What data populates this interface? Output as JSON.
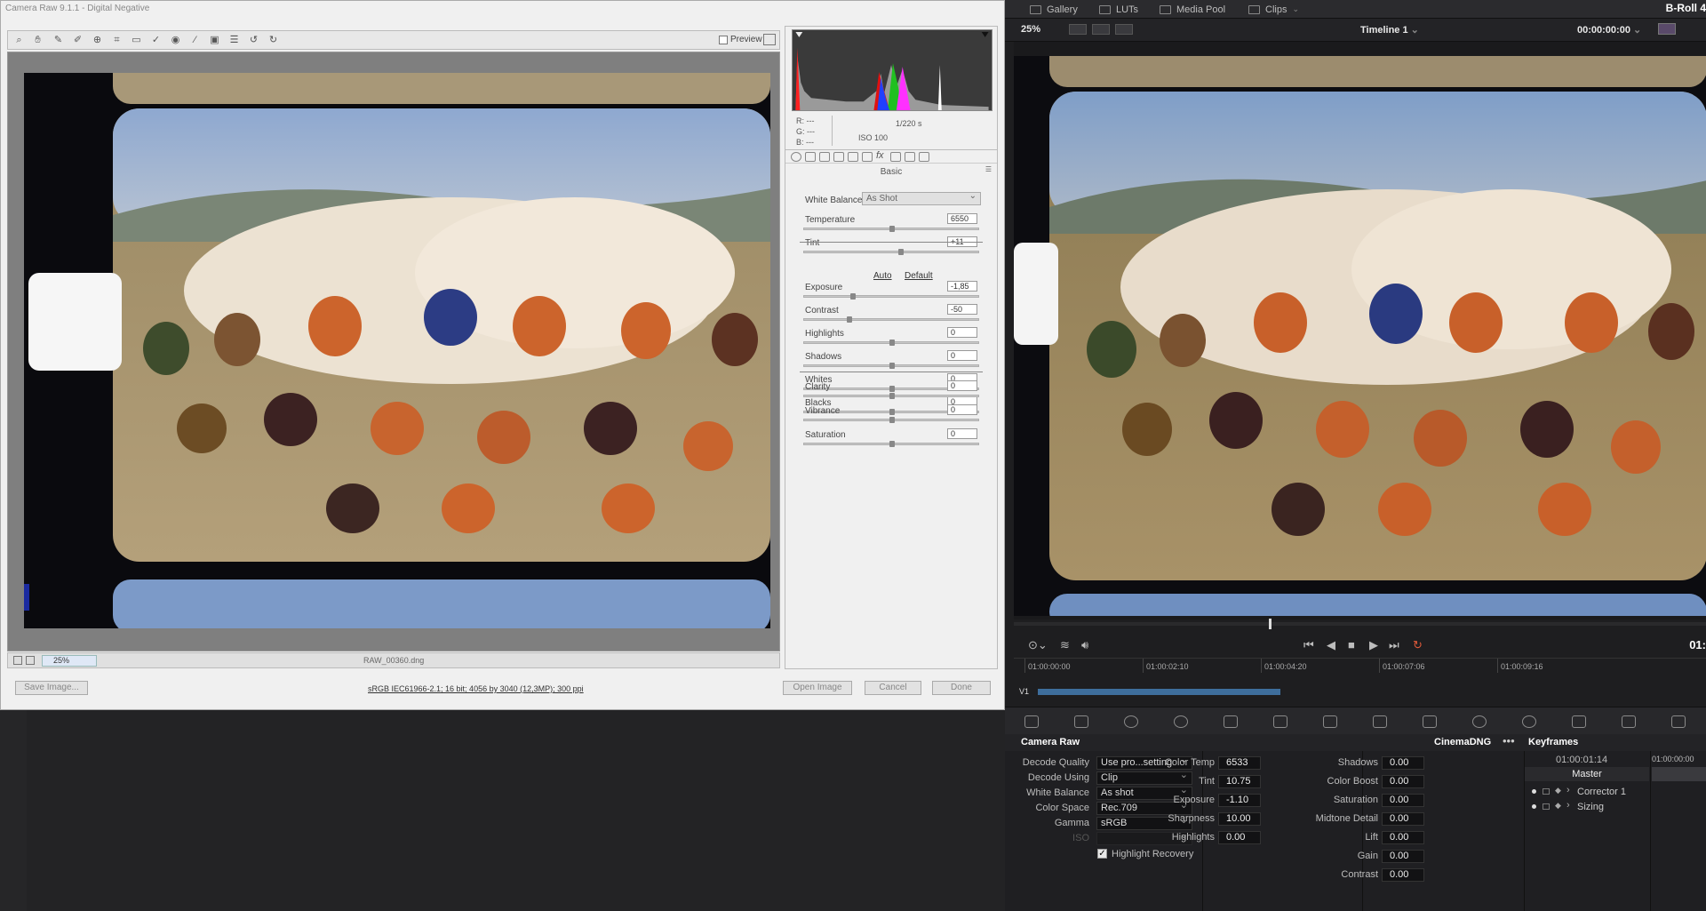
{
  "camera_raw": {
    "title": "Camera Raw 9.1.1  -  Digital Negative",
    "preview_label": "Preview",
    "rgb": {
      "r": "R:   ---",
      "g": "G:   ---",
      "b": "B:   ---"
    },
    "shutter": "1/220 s",
    "iso": "ISO 100",
    "panel_title": "Basic",
    "white_balance_label": "White Balance:",
    "white_balance_value": "As Shot",
    "sliders_wb": [
      {
        "label": "Temperature",
        "value": "6550",
        "pos": 0.5
      },
      {
        "label": "Tint",
        "value": "+11",
        "pos": 0.55
      }
    ],
    "auto_label": "Auto",
    "default_label": "Default",
    "sliders_tone": [
      {
        "label": "Exposure",
        "value": "-1,85",
        "pos": 0.27
      },
      {
        "label": "Contrast",
        "value": "-50",
        "pos": 0.25
      },
      {
        "label": "Highlights",
        "value": "0",
        "pos": 0.5
      },
      {
        "label": "Shadows",
        "value": "0",
        "pos": 0.5
      },
      {
        "label": "Whites",
        "value": "0",
        "pos": 0.5
      },
      {
        "label": "Blacks",
        "value": "0",
        "pos": 0.5
      }
    ],
    "sliders_presence": [
      {
        "label": "Clarity",
        "value": "0",
        "pos": 0.5
      },
      {
        "label": "Vibrance",
        "value": "0",
        "pos": 0.5
      },
      {
        "label": "Saturation",
        "value": "0",
        "pos": 0.5
      }
    ],
    "zoom": "25%",
    "filename": "RAW_00360.dng",
    "save_image": "Save Image...",
    "workflow_info": "sRGB IEC61966-2.1; 16 bit; 4056 by 3040 (12,3MP); 300 ppi",
    "open_image": "Open Image",
    "cancel": "Cancel",
    "done": "Done"
  },
  "resolve": {
    "tabs": [
      "Gallery",
      "LUTs",
      "Media Pool",
      "Clips"
    ],
    "project": "B-Roll 4",
    "viewer_zoom": "25%",
    "timeline_name": "Timeline 1",
    "timecode": "00:00:00:00",
    "timecode_right": "01:",
    "ruler": [
      "01:00:00:00",
      "01:00:02:10",
      "01:00:04:20",
      "01:00:07:06",
      "01:00:09:16"
    ],
    "track": "V1",
    "panel_title": "Camera Raw",
    "format": "CinemaDNG",
    "keyframes_title": "Keyframes",
    "decode": [
      {
        "label": "Decode Quality",
        "value": "Use pro...setting"
      },
      {
        "label": "Decode Using",
        "value": "Clip"
      },
      {
        "label": "White Balance",
        "value": "As shot"
      },
      {
        "label": "Color Space",
        "value": "Rec.709"
      },
      {
        "label": "Gamma",
        "value": "sRGB"
      },
      {
        "label": "ISO",
        "value": ""
      }
    ],
    "highlight_recovery": "Highlight Recovery",
    "params_mid": [
      {
        "label": "Color Temp",
        "value": "6533"
      },
      {
        "label": "Tint",
        "value": "10.75"
      },
      {
        "label": "Exposure",
        "value": "-1.10"
      },
      {
        "label": "Sharpness",
        "value": "10.00"
      },
      {
        "label": "Highlights",
        "value": "0.00"
      }
    ],
    "params_right": [
      {
        "label": "Shadows",
        "value": "0.00"
      },
      {
        "label": "Color Boost",
        "value": "0.00"
      },
      {
        "label": "Saturation",
        "value": "0.00"
      },
      {
        "label": "Midtone Detail",
        "value": "0.00"
      },
      {
        "label": "Lift",
        "value": "0.00"
      },
      {
        "label": "Gain",
        "value": "0.00"
      },
      {
        "label": "Contrast",
        "value": "0.00"
      }
    ],
    "kf_timecode": "01:00:01:14",
    "kf_timecode2": "01:00:00:00",
    "kf_master": "Master",
    "kf_items": [
      "Corrector 1",
      "Sizing"
    ]
  }
}
